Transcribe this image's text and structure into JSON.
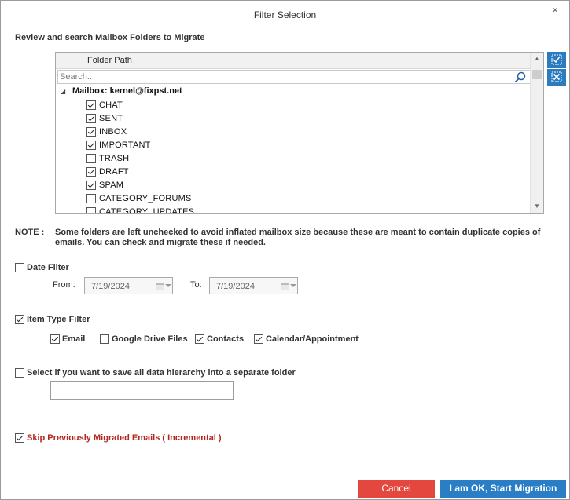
{
  "window": {
    "title": "Filter Selection",
    "close_glyph": "×"
  },
  "folders_section": {
    "heading": "Review and search Mailbox Folders to Migrate",
    "column_header": "Folder Path",
    "search_placeholder": "Search..",
    "root_label": "Mailbox: kernel@fixpst.net",
    "items": [
      {
        "label": "CHAT",
        "checked": true
      },
      {
        "label": "SENT",
        "checked": true
      },
      {
        "label": "INBOX",
        "checked": true
      },
      {
        "label": "IMPORTANT",
        "checked": true
      },
      {
        "label": "TRASH",
        "checked": false
      },
      {
        "label": "DRAFT",
        "checked": true
      },
      {
        "label": "SPAM",
        "checked": true
      },
      {
        "label": "CATEGORY_FORUMS",
        "checked": false
      },
      {
        "label": "CATEGORY_UPDATES",
        "checked": false
      }
    ]
  },
  "note": {
    "label": "NOTE :",
    "text": "Some folders are left unchecked to avoid inflated mailbox size because these are meant to contain duplicate copies of emails. You can check and migrate these if needed."
  },
  "date_filter": {
    "label": "Date Filter",
    "checked": false,
    "from_label": "From:",
    "from_value": "7/19/2024",
    "to_label": "To:",
    "to_value": "7/19/2024"
  },
  "item_type_filter": {
    "label": "Item Type Filter",
    "checked": true,
    "options": [
      {
        "label": "Email",
        "checked": true
      },
      {
        "label": "Google Drive Files",
        "checked": false
      },
      {
        "label": "Contacts",
        "checked": true
      },
      {
        "label": "Calendar/Appointment",
        "checked": true
      }
    ]
  },
  "hierarchy": {
    "label": "Select if you want to save all data hierarchy into a separate folder",
    "checked": false,
    "folder_value": ""
  },
  "incremental": {
    "label": "Skip Previously Migrated Emails ( Incremental )",
    "checked": true
  },
  "buttons": {
    "cancel": "Cancel",
    "ok": "I am OK, Start Migration"
  },
  "colors": {
    "accent_blue": "#2a7ec6",
    "cancel_red": "#e4473d",
    "incremental_red": "#b3261e"
  }
}
